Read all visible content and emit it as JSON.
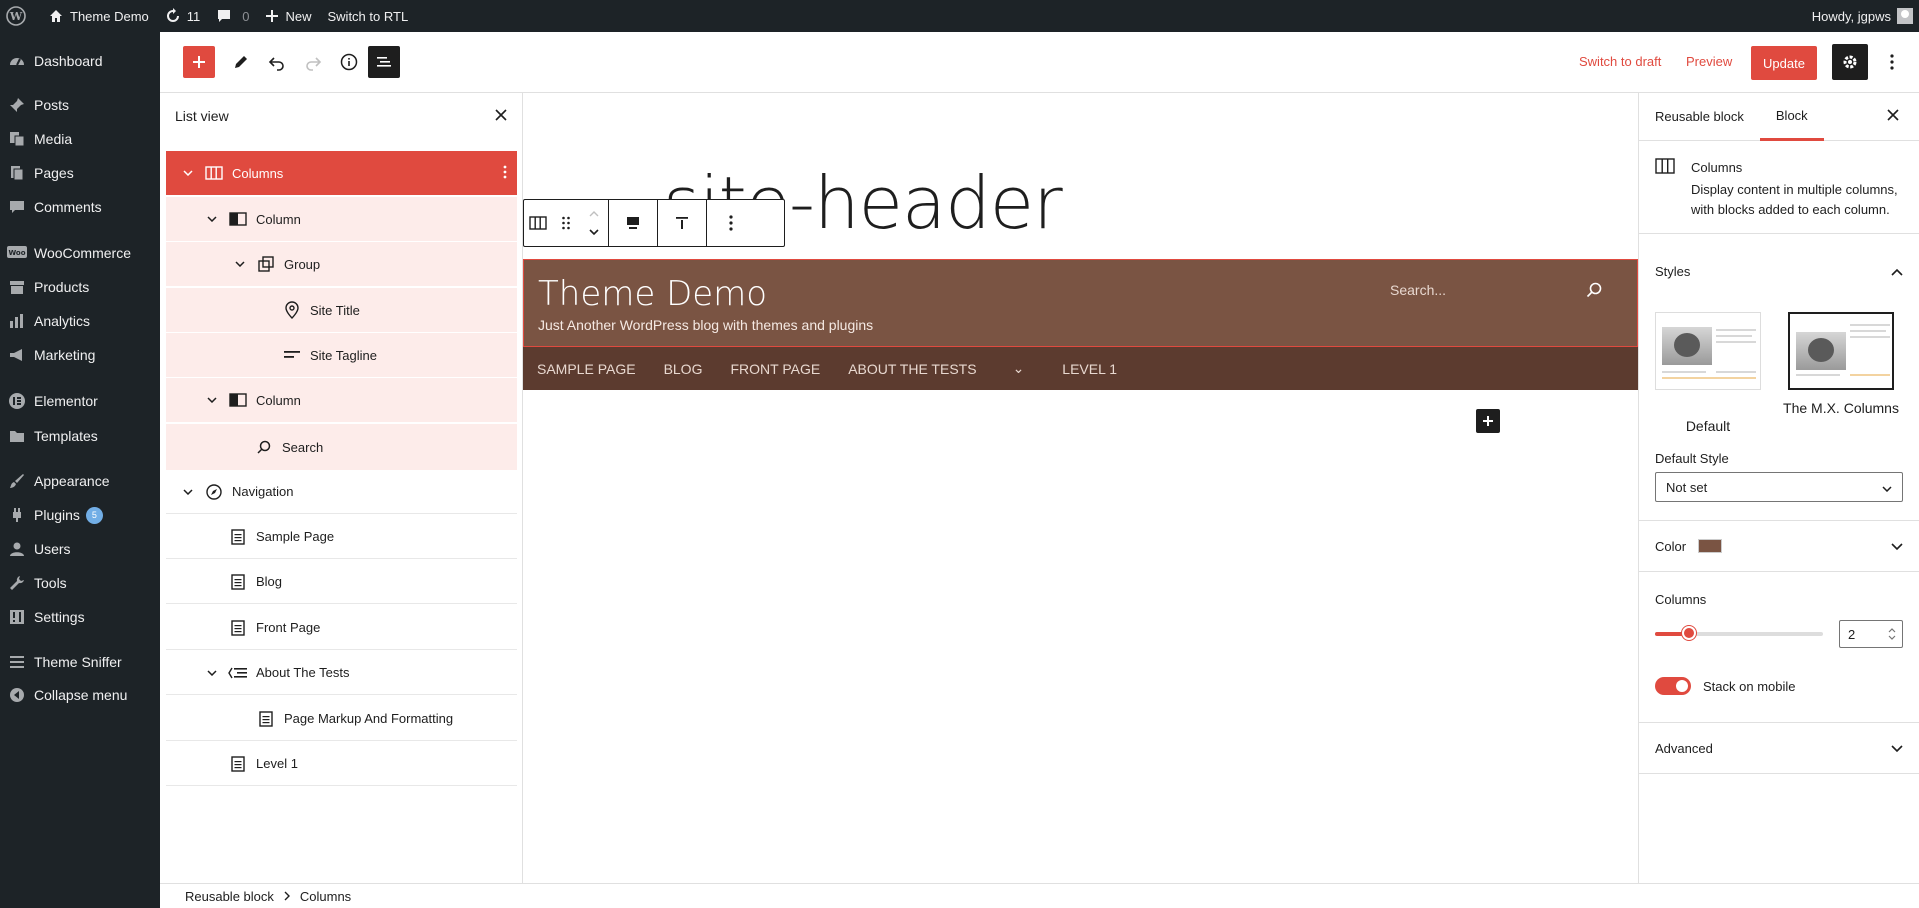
{
  "admin_bar": {
    "site_name": "Theme Demo",
    "updates_count": "11",
    "comments_count": "0",
    "new_label": "New",
    "rtl_label": "Switch to RTL",
    "howdy": "Howdy, jgpws"
  },
  "sidebar": {
    "items": [
      {
        "label": "Dashboard",
        "icon": "dashboard-icon"
      },
      {
        "label": "Posts",
        "icon": "pin-icon"
      },
      {
        "label": "Media",
        "icon": "media-icon"
      },
      {
        "label": "Pages",
        "icon": "pages-icon"
      },
      {
        "label": "Comments",
        "icon": "comment-icon"
      },
      {
        "label": "WooCommerce",
        "icon": "woo-icon"
      },
      {
        "label": "Products",
        "icon": "archive-icon"
      },
      {
        "label": "Analytics",
        "icon": "chart-icon"
      },
      {
        "label": "Marketing",
        "icon": "megaphone-icon"
      },
      {
        "label": "Elementor",
        "icon": "elementor-icon"
      },
      {
        "label": "Templates",
        "icon": "folder-icon"
      },
      {
        "label": "Appearance",
        "icon": "brush-icon"
      },
      {
        "label": "Plugins",
        "icon": "plugin-icon",
        "badge": "5"
      },
      {
        "label": "Users",
        "icon": "user-icon"
      },
      {
        "label": "Tools",
        "icon": "wrench-icon"
      },
      {
        "label": "Settings",
        "icon": "settings-icon"
      },
      {
        "label": "Theme Sniffer",
        "icon": "list-icon"
      },
      {
        "label": "Collapse menu",
        "icon": "collapse-icon"
      }
    ]
  },
  "toolbar": {
    "switch_draft": "Switch to draft",
    "preview": "Preview",
    "update": "Update"
  },
  "list_view": {
    "title": "List view",
    "rows": [
      {
        "label": "Columns",
        "icon": "columns-icon",
        "expanded": true
      },
      {
        "label": "Column",
        "icon": "column-icon",
        "expanded": true
      },
      {
        "label": "Group",
        "icon": "group-icon",
        "expanded": true
      },
      {
        "label": "Site Title",
        "icon": "location-icon"
      },
      {
        "label": "Site Tagline",
        "icon": "tagline-icon"
      },
      {
        "label": "Column",
        "icon": "column-icon",
        "expanded": true
      },
      {
        "label": "Search",
        "icon": "search-icon"
      },
      {
        "label": "Navigation",
        "icon": "navigation-icon",
        "expanded": true
      },
      {
        "label": "Sample Page",
        "icon": "page-icon"
      },
      {
        "label": "Blog",
        "icon": "page-icon"
      },
      {
        "label": "Front Page",
        "icon": "page-icon"
      },
      {
        "label": "About The Tests",
        "icon": "submenu-icon",
        "expanded": true
      },
      {
        "label": "Page Markup And Formatting",
        "icon": "page-icon"
      },
      {
        "label": "Level 1",
        "icon": "page-icon"
      }
    ]
  },
  "canvas": {
    "header_text": "site-header",
    "site_title": "Theme Demo",
    "site_tagline": "Just Another WordPress blog with themes and plugins",
    "search_placeholder": "Search...",
    "nav_items": [
      "Sample Page",
      "Blog",
      "Front Page",
      "About The Tests",
      "⌄",
      "Level 1"
    ]
  },
  "settings": {
    "tabs": [
      "Reusable block",
      "Block"
    ],
    "block_title": "Columns",
    "block_desc": "Display content in multiple columns, with blocks added to each column.",
    "styles_label": "Styles",
    "style_default": "Default",
    "style_mx": "The M.X. Columns",
    "default_style_label": "Default Style",
    "default_style_value": "Not set",
    "color_label": "Color",
    "color_value": "#7a5443",
    "columns_label": "Columns",
    "columns_value": "2",
    "columns_slider_fraction": 0.2,
    "stack_label": "Stack on mobile",
    "advanced_label": "Advanced"
  },
  "breadcrumb": [
    "Reusable block",
    "Columns"
  ],
  "colors": {
    "accent": "#e04a3f",
    "admin_dark": "#1d2327",
    "brown": "#7a5443",
    "brown_dark": "#5c3b2f"
  }
}
